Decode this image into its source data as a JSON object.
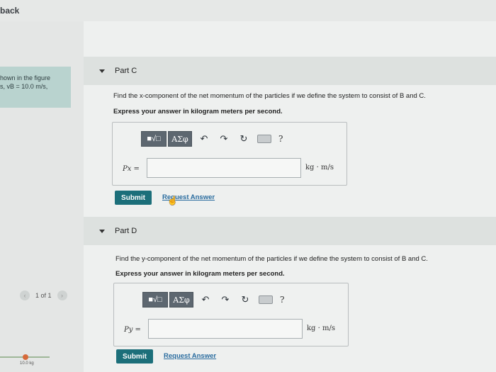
{
  "header": {
    "feedback_label": "back"
  },
  "sidebar": {
    "figure_note_line1": "hown in the figure",
    "figure_note_line2": "s, vB = 10.0 m/s,",
    "pager_text": "1 of 1",
    "prev_icon": "chevron-left-icon",
    "next_icon": "chevron-right-icon",
    "mini_fig_label": "10.0 kg"
  },
  "partC": {
    "title": "Part C",
    "question": "Find the x-component of the net momentum of the particles if we define the system to consist of B and C.",
    "instruction": "Express your answer in kilogram meters per second.",
    "toolbar": {
      "frac_label": "■√□",
      "greek_label": "ΑΣφ",
      "undo_icon": "↶",
      "redo_icon": "↷",
      "reset_icon": "↻",
      "help_label": "?"
    },
    "var_label": "Px =",
    "input_value": "",
    "unit": "kg · m/s",
    "submit_label": "Submit",
    "request_label": "Request Answer"
  },
  "partD": {
    "title": "Part D",
    "question": "Find the y-component of the net momentum of the particles if we define the system to consist of B and C.",
    "instruction": "Express your answer in kilogram meters per second.",
    "toolbar": {
      "frac_label": "■√□",
      "greek_label": "ΑΣφ",
      "undo_icon": "↶",
      "redo_icon": "↷",
      "reset_icon": "↻",
      "help_label": "?"
    },
    "var_label": "Py =",
    "input_value": "",
    "unit": "kg · m/s",
    "submit_label": "Submit",
    "request_label": "Request Answer"
  }
}
